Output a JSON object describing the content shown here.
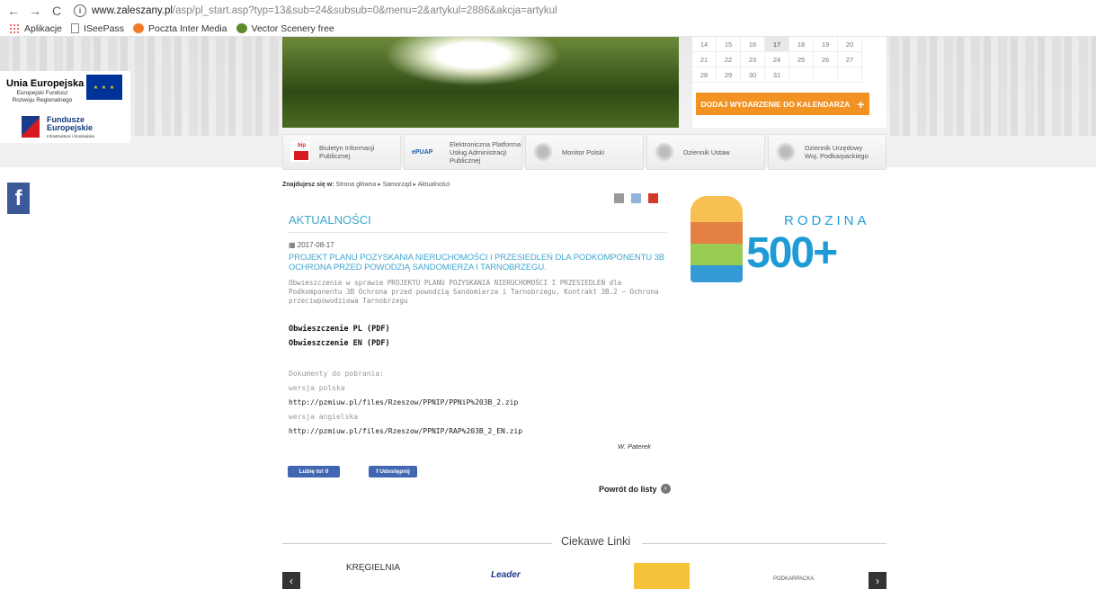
{
  "browser": {
    "url_host": "www.zaleszany.pl",
    "url_path": "/asp/pl_start.asp?typ=13&sub=24&subsub=0&menu=2&artykul=2886&akcja=artykul",
    "bookmarks": [
      "Aplikacje",
      "ISeePass",
      "Poczta Inter Media",
      "Vector Scenery free"
    ]
  },
  "eu": {
    "title": "Unia Europejska",
    "subtitle": "Europejski Fundusz Rozwoju Regionalnego",
    "fe_title": "Fundusze Europejskie",
    "fe_sub": "Infrastruktura i Środowisko"
  },
  "calendar": {
    "rows": [
      [
        "14",
        "15",
        "16",
        "17",
        "18",
        "19",
        "20"
      ],
      [
        "21",
        "22",
        "23",
        "24",
        "25",
        "26",
        "27"
      ],
      [
        "28",
        "29",
        "30",
        "31",
        "",
        "",
        ""
      ]
    ],
    "today": "17",
    "add_label": "DODAJ WYDARZENIE DO KALENDARZA",
    "add_plus": "+"
  },
  "linkbar": [
    {
      "icon": "bip-icon",
      "label": "Biuletyn Informacji Publicznej"
    },
    {
      "icon": "epuap-icon",
      "label": "Elektroniczna Platforma Usług Administracji Publicznej",
      "logo": "ePUAP"
    },
    {
      "icon": "eagle-icon",
      "label": "Monitor Polski"
    },
    {
      "icon": "eagle-icon",
      "label": "Dziennik Ustaw"
    },
    {
      "icon": "eagle-icon",
      "label": "Dziennik Urzędowy Woj. Podkarpackiego"
    }
  ],
  "breadcrumb": {
    "prefix": "Znajdujesz się w:",
    "items": [
      "Strona główna",
      "Samorząd",
      "Aktualności"
    ]
  },
  "article": {
    "section_title": "AKTUALNOŚCI",
    "date": "2017-08-17",
    "headline": "PROJEKT PLANU POZYSKANIA NIERUCHOMOŚCI I PRZESIEDLEŃ DLA PODKOMPONENTU 3B OCHRONA PRZED POWODZIĄ SANDOMIERZA I TARNOBRZEGU.",
    "lead": "Obwieszczenie w sprawie PROJEKTU PLANU POZYSKANIA NIERUCHOMOŚCI I PRZESIEDLEŃ dla Podkomponentu 3B Ochrona przed powodzią Sandomierza i Tarnobrzegu, Kontrakt 3B.2 – Ochrona przeciwpowodziowa Tarnobrzegu",
    "pdf_pl": "Obwieszczenie PL (PDF)",
    "pdf_en": "Obwieszczenie EN (PDF)",
    "downloads_label": "Dokumenty do pobrania:",
    "pl_label": "wersja polska",
    "pl_url": "http://pzmiuw.pl/files/Rzeszow/PPNIP/PPNiP%203B_2.zip",
    "en_label": "wersja angielska",
    "en_url": "http://pzmiuw.pl/files/Rzeszow/PPNIP/RAP%203B_2_EN.zip",
    "author": "W. Paterek",
    "like_label": "Lubię to! 0",
    "share_label": "f Udostępnij",
    "back_label": "Powrót do listy"
  },
  "promo": {
    "word": "RODZINA",
    "number": "500+"
  },
  "links_section": {
    "title": "Ciekawe Linki",
    "items": [
      "KRĘGIELNIA",
      "Leader",
      "",
      "PODKARPACKA"
    ]
  },
  "colors": {
    "accent_blue": "#3fa6d0",
    "orange": "#f29222",
    "facebook": "#3b5998"
  }
}
